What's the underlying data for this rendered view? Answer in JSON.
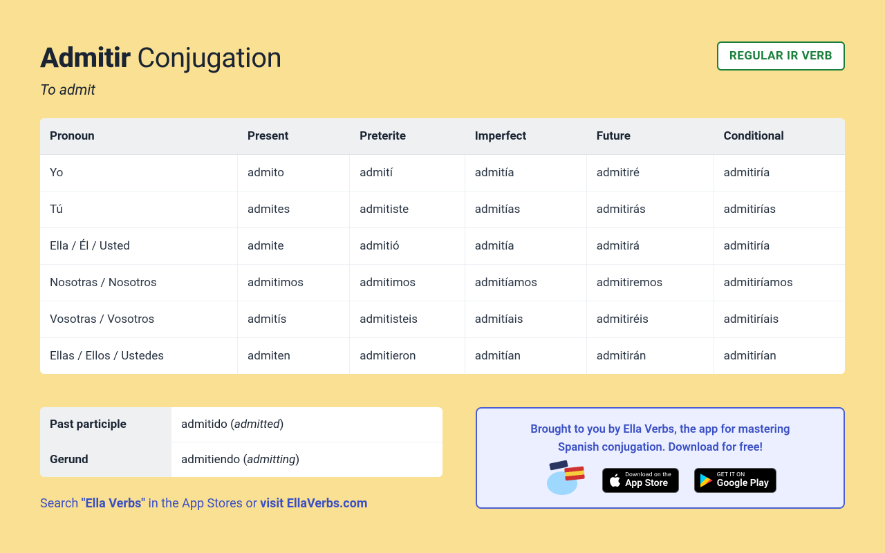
{
  "header": {
    "verb": "Admitir",
    "title_suffix": "Conjugation",
    "subtitle": "To admit",
    "badge": "REGULAR IR VERB"
  },
  "table": {
    "headers": [
      "Pronoun",
      "Present",
      "Preterite",
      "Imperfect",
      "Future",
      "Conditional"
    ],
    "rows": [
      [
        "Yo",
        "admito",
        "admití",
        "admitía",
        "admitiré",
        "admitiría"
      ],
      [
        "Tú",
        "admites",
        "admitiste",
        "admitías",
        "admitirás",
        "admitirías"
      ],
      [
        "Ella / Él / Usted",
        "admite",
        "admitió",
        "admitía",
        "admitirá",
        "admitiría"
      ],
      [
        "Nosotras / Nosotros",
        "admitimos",
        "admitimos",
        "admitíamos",
        "admitiremos",
        "admitiríamos"
      ],
      [
        "Vosotras / Vosotros",
        "admitís",
        "admitisteis",
        "admitíais",
        "admitiréis",
        "admitiríais"
      ],
      [
        "Ellas / Ellos / Ustedes",
        "admiten",
        "admitieron",
        "admitían",
        "admitirán",
        "admitirían"
      ]
    ]
  },
  "forms": {
    "past_participle": {
      "label": "Past participle",
      "value": "admitido",
      "translation": "admitted"
    },
    "gerund": {
      "label": "Gerund",
      "value": "admitiendo",
      "translation": "admitting"
    }
  },
  "search_line": {
    "prefix": "Search ",
    "quoted": "\"Ella Verbs\"",
    "middle": " in the App Stores or ",
    "link": "visit EllaVerbs.com"
  },
  "promo": {
    "line1": "Brought to you by Ella Verbs, the app for mastering",
    "line2": "Spanish conjugation. Download for free!",
    "app_store": {
      "small": "Download on the",
      "big": "App Store"
    },
    "google_play": {
      "small": "GET IT ON",
      "big": "Google Play"
    }
  }
}
